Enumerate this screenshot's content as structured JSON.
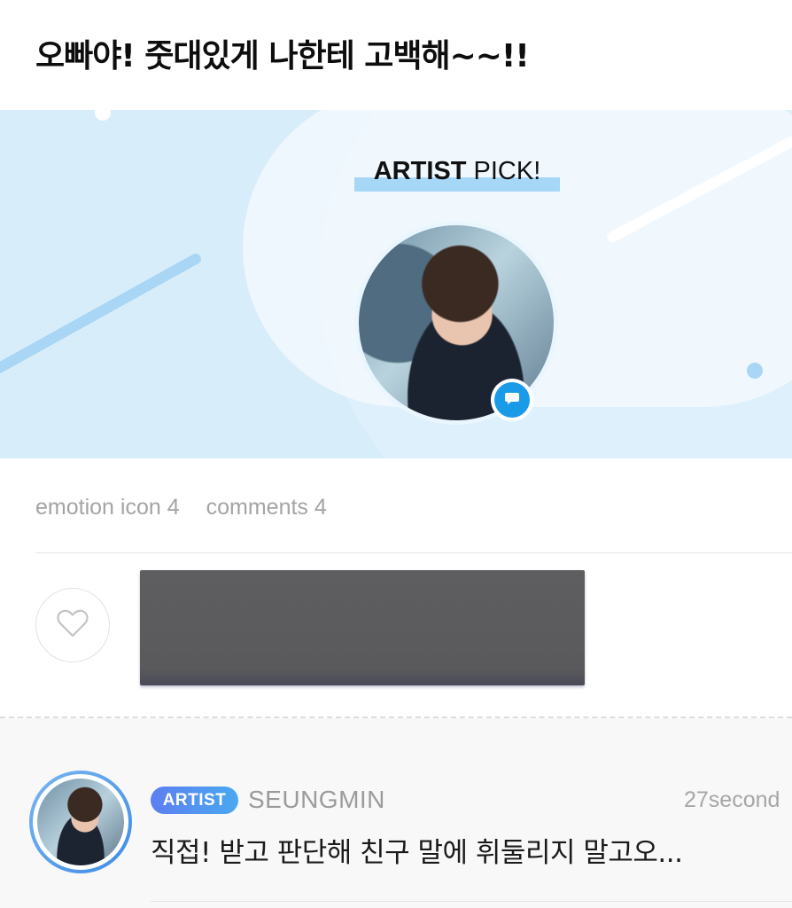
{
  "post": {
    "title": "오빠야! 줏대있게 나한테 고백해~~!!"
  },
  "banner": {
    "pick_bold": "ARTIST",
    "pick_rest": " PICK!",
    "profile_icon": "chat-bubble-icon",
    "colors": {
      "background": "#d7edfa",
      "highlight": "#a6d7f7",
      "badge": "#1a9be8"
    }
  },
  "stats": {
    "emotion": "emotion icon 4",
    "comments": "comments 4"
  },
  "actions": {
    "like_icon": "heart-icon"
  },
  "comment": {
    "badge": "ARTIST",
    "author": "SEUNGMIN",
    "time": "27second",
    "text": "직접! 받고 판단해 친구 말에 휘둘리지 말고오...",
    "badge_color": "#5d7ff0"
  }
}
